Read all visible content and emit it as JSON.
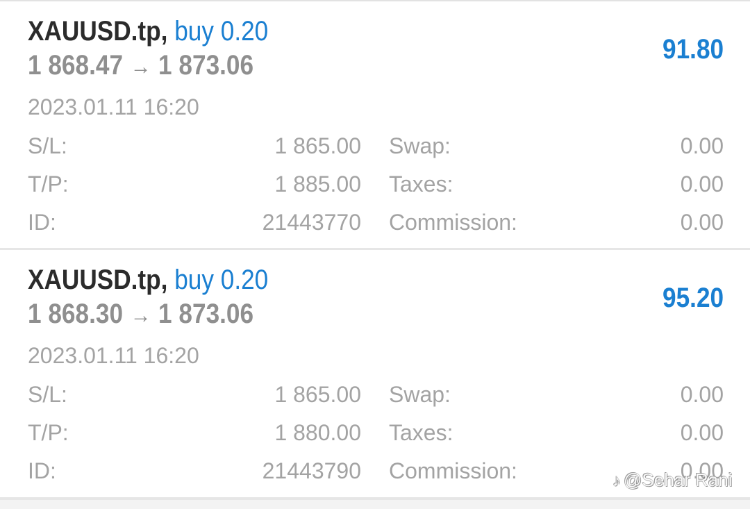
{
  "positions": [
    {
      "symbol": "XAUUSD.tp,",
      "order": "buy 0.20",
      "open_price": "1 868.47",
      "arrow": "→",
      "current_price": "1 873.06",
      "profit": "91.80",
      "datetime": "2023.01.11 16:20",
      "sl_label": "S/L:",
      "sl_value": "1 865.00",
      "tp_label": "T/P:",
      "tp_value": "1 885.00",
      "id_label": "ID:",
      "id_value": "21443770",
      "swap_label": "Swap:",
      "swap_value": "0.00",
      "taxes_label": "Taxes:",
      "taxes_value": "0.00",
      "commission_label": "Commission:",
      "commission_value": "0.00"
    },
    {
      "symbol": "XAUUSD.tp,",
      "order": "buy 0.20",
      "open_price": "1 868.30",
      "arrow": "→",
      "current_price": "1 873.06",
      "profit": "95.20",
      "datetime": "2023.01.11 16:20",
      "sl_label": "S/L:",
      "sl_value": "1 865.00",
      "tp_label": "T/P:",
      "tp_value": "1 880.00",
      "id_label": "ID:",
      "id_value": "21443790",
      "swap_label": "Swap:",
      "swap_value": "0.00",
      "taxes_label": "Taxes:",
      "taxes_value": "0.00",
      "commission_label": "Commission:",
      "commission_value": "0.00"
    }
  ],
  "watermark": {
    "logo_icon": "♪",
    "text": "@Sehar Rani"
  },
  "colors": {
    "accent": "#1a7fd1",
    "symbol": "#2b2b2b",
    "price": "#8f8f8f",
    "muted": "#a3a3a3"
  }
}
